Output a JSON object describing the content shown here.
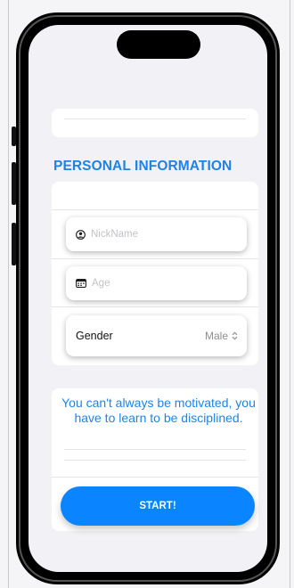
{
  "section_title": "PERSONAL INFORMATION",
  "form": {
    "nickname": {
      "value": "",
      "placeholder": "NickName",
      "icon": "person-circle-icon"
    },
    "age": {
      "value": "",
      "placeholder": "Age",
      "icon": "calendar-icon"
    },
    "gender": {
      "label": "Gender",
      "value": "Male",
      "icon": "chevron-up-down-icon"
    }
  },
  "quote": "You can't always be motivated, you have to learn to be disciplined.",
  "start_button": {
    "label": "START!"
  },
  "colors": {
    "accent": "#0a84ff",
    "title": "#1e82e6",
    "background": "#f1f1f6"
  }
}
